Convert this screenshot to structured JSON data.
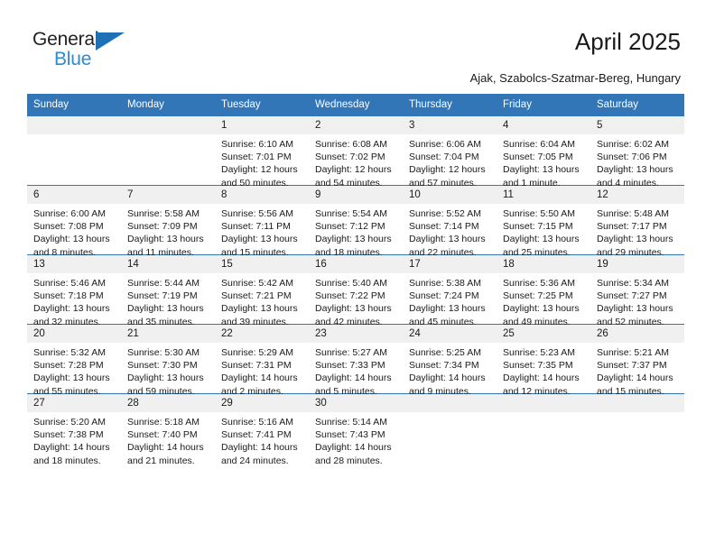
{
  "brand": {
    "name_part1": "General",
    "name_part2": "Blue"
  },
  "header": {
    "title": "April 2025",
    "subtitle": "Ajak, Szabolcs-Szatmar-Bereg, Hungary"
  },
  "colors": {
    "header_blue": "#3276b8",
    "daynum_band": "#f0f0f0",
    "logo_blue": "#2e8ad4",
    "logo_triangle": "#1f6fb5"
  },
  "weekday_headers": [
    "Sunday",
    "Monday",
    "Tuesday",
    "Wednesday",
    "Thursday",
    "Friday",
    "Saturday"
  ],
  "weeks": [
    [
      {
        "day": "",
        "lines": []
      },
      {
        "day": "",
        "lines": []
      },
      {
        "day": "1",
        "lines": [
          "Sunrise: 6:10 AM",
          "Sunset: 7:01 PM",
          "Daylight: 12 hours",
          "and 50 minutes."
        ]
      },
      {
        "day": "2",
        "lines": [
          "Sunrise: 6:08 AM",
          "Sunset: 7:02 PM",
          "Daylight: 12 hours",
          "and 54 minutes."
        ]
      },
      {
        "day": "3",
        "lines": [
          "Sunrise: 6:06 AM",
          "Sunset: 7:04 PM",
          "Daylight: 12 hours",
          "and 57 minutes."
        ]
      },
      {
        "day": "4",
        "lines": [
          "Sunrise: 6:04 AM",
          "Sunset: 7:05 PM",
          "Daylight: 13 hours",
          "and 1 minute."
        ]
      },
      {
        "day": "5",
        "lines": [
          "Sunrise: 6:02 AM",
          "Sunset: 7:06 PM",
          "Daylight: 13 hours",
          "and 4 minutes."
        ]
      }
    ],
    [
      {
        "day": "6",
        "lines": [
          "Sunrise: 6:00 AM",
          "Sunset: 7:08 PM",
          "Daylight: 13 hours",
          "and 8 minutes."
        ]
      },
      {
        "day": "7",
        "lines": [
          "Sunrise: 5:58 AM",
          "Sunset: 7:09 PM",
          "Daylight: 13 hours",
          "and 11 minutes."
        ]
      },
      {
        "day": "8",
        "lines": [
          "Sunrise: 5:56 AM",
          "Sunset: 7:11 PM",
          "Daylight: 13 hours",
          "and 15 minutes."
        ]
      },
      {
        "day": "9",
        "lines": [
          "Sunrise: 5:54 AM",
          "Sunset: 7:12 PM",
          "Daylight: 13 hours",
          "and 18 minutes."
        ]
      },
      {
        "day": "10",
        "lines": [
          "Sunrise: 5:52 AM",
          "Sunset: 7:14 PM",
          "Daylight: 13 hours",
          "and 22 minutes."
        ]
      },
      {
        "day": "11",
        "lines": [
          "Sunrise: 5:50 AM",
          "Sunset: 7:15 PM",
          "Daylight: 13 hours",
          "and 25 minutes."
        ]
      },
      {
        "day": "12",
        "lines": [
          "Sunrise: 5:48 AM",
          "Sunset: 7:17 PM",
          "Daylight: 13 hours",
          "and 29 minutes."
        ]
      }
    ],
    [
      {
        "day": "13",
        "lines": [
          "Sunrise: 5:46 AM",
          "Sunset: 7:18 PM",
          "Daylight: 13 hours",
          "and 32 minutes."
        ]
      },
      {
        "day": "14",
        "lines": [
          "Sunrise: 5:44 AM",
          "Sunset: 7:19 PM",
          "Daylight: 13 hours",
          "and 35 minutes."
        ]
      },
      {
        "day": "15",
        "lines": [
          "Sunrise: 5:42 AM",
          "Sunset: 7:21 PM",
          "Daylight: 13 hours",
          "and 39 minutes."
        ]
      },
      {
        "day": "16",
        "lines": [
          "Sunrise: 5:40 AM",
          "Sunset: 7:22 PM",
          "Daylight: 13 hours",
          "and 42 minutes."
        ]
      },
      {
        "day": "17",
        "lines": [
          "Sunrise: 5:38 AM",
          "Sunset: 7:24 PM",
          "Daylight: 13 hours",
          "and 45 minutes."
        ]
      },
      {
        "day": "18",
        "lines": [
          "Sunrise: 5:36 AM",
          "Sunset: 7:25 PM",
          "Daylight: 13 hours",
          "and 49 minutes."
        ]
      },
      {
        "day": "19",
        "lines": [
          "Sunrise: 5:34 AM",
          "Sunset: 7:27 PM",
          "Daylight: 13 hours",
          "and 52 minutes."
        ]
      }
    ],
    [
      {
        "day": "20",
        "lines": [
          "Sunrise: 5:32 AM",
          "Sunset: 7:28 PM",
          "Daylight: 13 hours",
          "and 55 minutes."
        ]
      },
      {
        "day": "21",
        "lines": [
          "Sunrise: 5:30 AM",
          "Sunset: 7:30 PM",
          "Daylight: 13 hours",
          "and 59 minutes."
        ]
      },
      {
        "day": "22",
        "lines": [
          "Sunrise: 5:29 AM",
          "Sunset: 7:31 PM",
          "Daylight: 14 hours",
          "and 2 minutes."
        ]
      },
      {
        "day": "23",
        "lines": [
          "Sunrise: 5:27 AM",
          "Sunset: 7:33 PM",
          "Daylight: 14 hours",
          "and 5 minutes."
        ]
      },
      {
        "day": "24",
        "lines": [
          "Sunrise: 5:25 AM",
          "Sunset: 7:34 PM",
          "Daylight: 14 hours",
          "and 9 minutes."
        ]
      },
      {
        "day": "25",
        "lines": [
          "Sunrise: 5:23 AM",
          "Sunset: 7:35 PM",
          "Daylight: 14 hours",
          "and 12 minutes."
        ]
      },
      {
        "day": "26",
        "lines": [
          "Sunrise: 5:21 AM",
          "Sunset: 7:37 PM",
          "Daylight: 14 hours",
          "and 15 minutes."
        ]
      }
    ],
    [
      {
        "day": "27",
        "lines": [
          "Sunrise: 5:20 AM",
          "Sunset: 7:38 PM",
          "Daylight: 14 hours",
          "and 18 minutes."
        ]
      },
      {
        "day": "28",
        "lines": [
          "Sunrise: 5:18 AM",
          "Sunset: 7:40 PM",
          "Daylight: 14 hours",
          "and 21 minutes."
        ]
      },
      {
        "day": "29",
        "lines": [
          "Sunrise: 5:16 AM",
          "Sunset: 7:41 PM",
          "Daylight: 14 hours",
          "and 24 minutes."
        ]
      },
      {
        "day": "30",
        "lines": [
          "Sunrise: 5:14 AM",
          "Sunset: 7:43 PM",
          "Daylight: 14 hours",
          "and 28 minutes."
        ]
      },
      {
        "day": "",
        "lines": []
      },
      {
        "day": "",
        "lines": []
      },
      {
        "day": "",
        "lines": []
      }
    ]
  ]
}
